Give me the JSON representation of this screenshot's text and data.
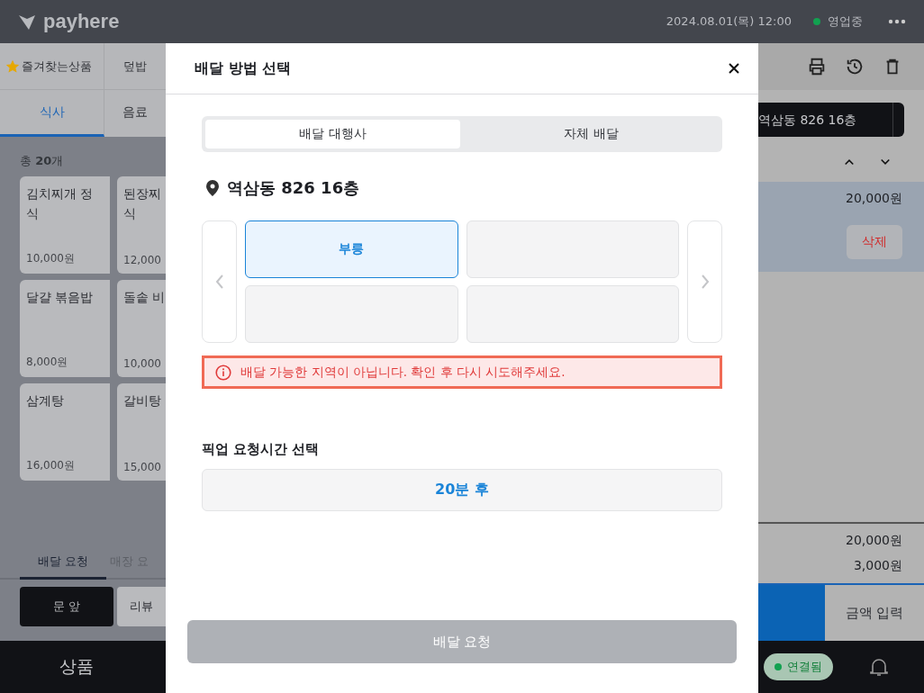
{
  "header": {
    "brand": "payhere",
    "datetime": "2024.08.01(목) 12:00",
    "status": {
      "label": "영업중",
      "color": "#12a150"
    }
  },
  "category_tabs": [
    {
      "label": "즐겨찾는상품",
      "kind": "favorites",
      "selected": false
    },
    {
      "label": "덮밥",
      "kind": "plain",
      "selected": false
    }
  ],
  "menu_tabs": [
    {
      "label": "식사",
      "selected": true
    },
    {
      "label": "음료",
      "selected": false
    }
  ],
  "item_count": "총 **20**개",
  "products": [
    {
      "lines": [
        "김치찌개 정",
        "식"
      ],
      "price": "10,000원"
    },
    {
      "lines": [
        "된장찌",
        "식"
      ],
      "price": "12,000"
    },
    {
      "lines": [
        "달걀 볶음밥"
      ],
      "price": "8,000원"
    },
    {
      "lines": [
        "돌솥 비"
      ],
      "price": "10,000"
    },
    {
      "lines": [
        "삼계탕"
      ],
      "price": "16,000원"
    },
    {
      "lines": [
        "갈비탕"
      ],
      "price": "15,000"
    }
  ],
  "request_tabs": [
    {
      "label": "배달 요청",
      "selected": true
    },
    {
      "label": "매장 요",
      "selected": false
    }
  ],
  "request_options": [
    {
      "label": "문 앞",
      "selected": true
    },
    {
      "label": "리뷰",
      "selected": false
    }
  ],
  "bottom_nav": {
    "products": "상품",
    "connection": {
      "label": "연결됨",
      "color": "#12a150"
    }
  },
  "order_panel": {
    "address": "역삼동 826 16층",
    "items": [
      {
        "price": "20,000원",
        "selected": true,
        "delete": "삭제"
      }
    ],
    "totals": [
      "20,000원",
      "3,000원"
    ],
    "amount_input": "금액 입력"
  },
  "modal": {
    "title": "배달 방법 선택",
    "method_tabs": [
      {
        "label": "배달 대행사",
        "selected": true
      },
      {
        "label": "자체 배달",
        "selected": false
      }
    ],
    "address": "역삼동 826 16층",
    "providers": [
      {
        "name": "부릉",
        "selected": true
      },
      {
        "selected": false
      },
      {
        "selected": false
      },
      {
        "selected": false
      }
    ],
    "error": "배달 가능한 지역이 아닙니다. 확인 후 다시 시도해주세요.",
    "pickup_label": "픽업 요청시간 선택",
    "pickup_time": "20분 후",
    "submit": {
      "label": "배달 요청",
      "disabled": true
    }
  }
}
